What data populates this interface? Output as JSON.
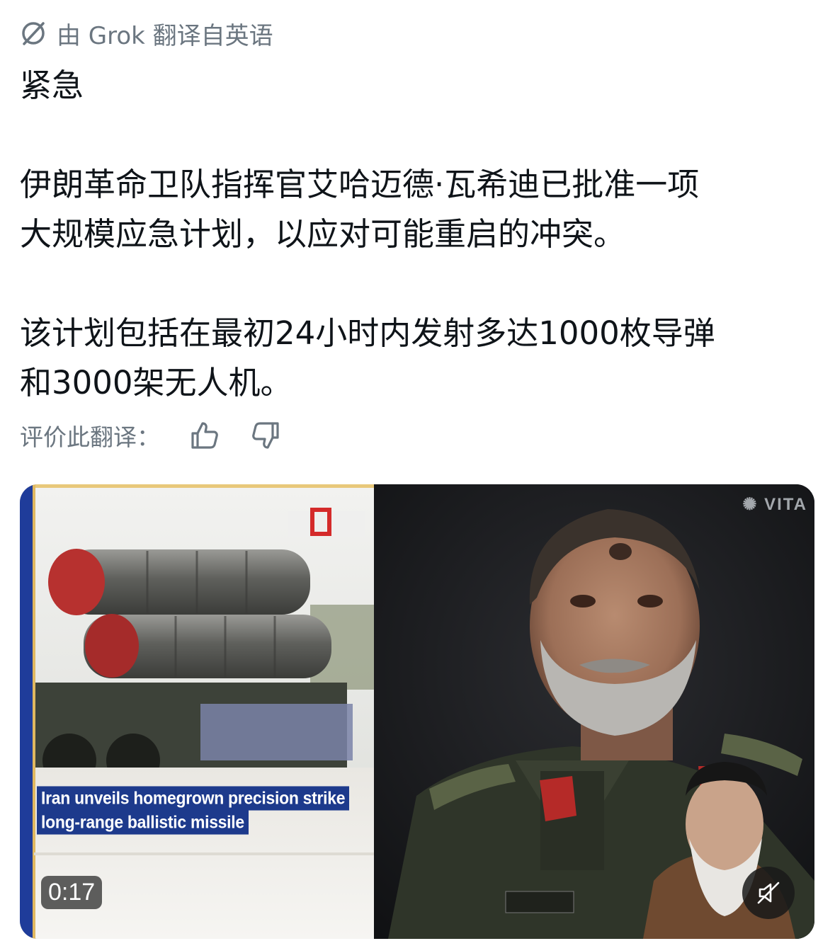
{
  "translation": {
    "notice": "由 Grok 翻译自英语",
    "icon": "translate-slash-icon"
  },
  "post": {
    "heading": "紧急",
    "paragraph1_line1": "伊朗革命卫队指挥官艾哈迈德·瓦希迪已批准一项",
    "paragraph1_line2": "大规模应急计划，以应对可能重启的冲突。",
    "paragraph2_line1": "该计划包括在最初24小时内发射多达1000枚导弹",
    "paragraph2_line2": "和3000架无人机。"
  },
  "rating": {
    "label": "评价此翻译：",
    "thumbs_up_icon": "thumbs-up-icon",
    "thumbs_down_icon": "thumbs-down-icon"
  },
  "video": {
    "caption_line1": "Iran unveils homegrown precision strike",
    "caption_line2": "long-range ballistic missile",
    "watermark": "VITA",
    "duration": "0:17",
    "mute_icon": "muted-speaker-icon"
  },
  "colors": {
    "text": "#0f1419",
    "secondary": "#6b7680",
    "caption_bg": "#1d3a8c"
  }
}
